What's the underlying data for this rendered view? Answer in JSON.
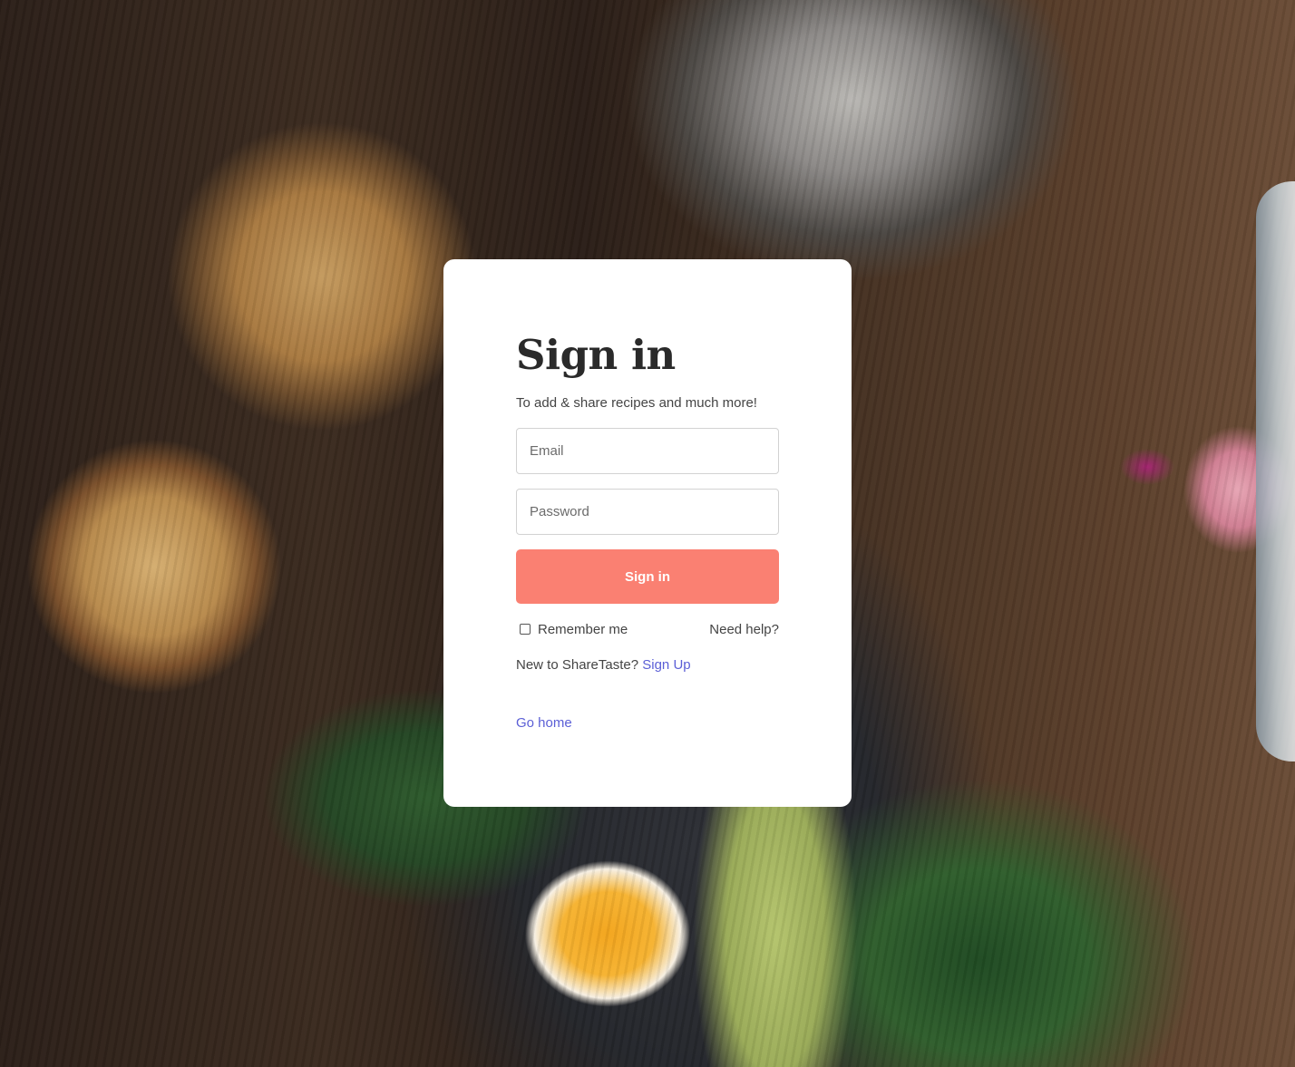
{
  "form": {
    "title": "Sign in",
    "subtitle": "To add & share recipes and much more!",
    "email_placeholder": "Email",
    "password_placeholder": "Password",
    "submit_label": "Sign in",
    "remember_label": "Remember me",
    "remember_checked": false,
    "help_label": "Need help?",
    "new_user_text": "New to ShareTaste?",
    "signup_label": "Sign Up",
    "home_label": "Go home"
  },
  "colors": {
    "accent": "#fa8072",
    "link": "#5b5fd6",
    "card_background": "#ffffff"
  }
}
